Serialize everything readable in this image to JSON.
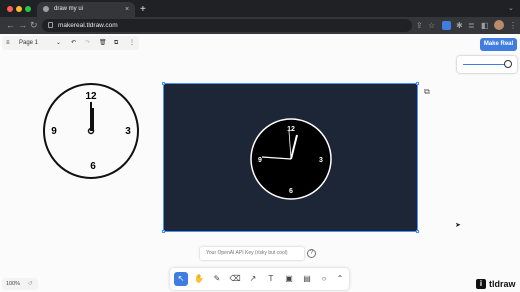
{
  "browser": {
    "tab_title": "draw my ui",
    "tab_close": "×",
    "new_tab": "+",
    "url": "makereal.tldraw.com",
    "back": "←",
    "forward": "→",
    "reload": "↻"
  },
  "menu": {
    "hamburger": "≡",
    "page_name": "Page 1",
    "chevron": "⌄"
  },
  "top_right": {
    "make_real_label": "Make Real",
    "slider_value": 1.0
  },
  "clock_drawing": {
    "numbers": [
      "12",
      "3",
      "6",
      "9"
    ],
    "hour_hand_angle_deg": 0,
    "minute_hand_angle_deg": 0
  },
  "frame_clock": {
    "numbers": [
      "12",
      "3",
      "6",
      "9"
    ],
    "hour_hand_angle_deg": 15,
    "minute_hand_angle_deg": 280,
    "second_hand_angle_deg": -5
  },
  "api_key": {
    "placeholder": "Your OpenAI API Key (risky but cool)",
    "help": "?"
  },
  "tools": [
    {
      "name": "select",
      "glyph": "↖",
      "active": true
    },
    {
      "name": "hand",
      "glyph": "✋",
      "active": false
    },
    {
      "name": "draw",
      "glyph": "✎",
      "active": false
    },
    {
      "name": "eraser",
      "glyph": "⌫",
      "active": false
    },
    {
      "name": "arrow",
      "glyph": "↗",
      "active": false
    },
    {
      "name": "text",
      "glyph": "T",
      "active": false
    },
    {
      "name": "note",
      "glyph": "▣",
      "active": false
    },
    {
      "name": "image",
      "glyph": "▤",
      "active": false
    },
    {
      "name": "ellipse",
      "glyph": "○",
      "active": false
    },
    {
      "name": "more",
      "glyph": "⌃",
      "active": false
    }
  ],
  "zoom": {
    "level": "100%",
    "undo": "↺"
  },
  "brand": {
    "mark": "i",
    "label": "tldraw"
  },
  "colors": {
    "accent": "#3f7de0",
    "frame_bg": "#1d2636",
    "selection": "#4b90ff"
  }
}
